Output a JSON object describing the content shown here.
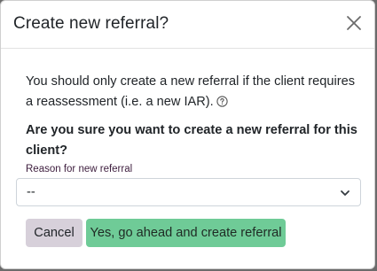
{
  "modal": {
    "title": "Create new referral?",
    "close_icon": "close-icon",
    "body_text": "You should only create a new referral if the client requires a reassessment (i.e. a new IAR).",
    "help_icon": "question-circle-icon",
    "question": "Are you sure you want to create a new referral for this client?",
    "reason_field": {
      "label": "Reason for new referral",
      "selected_value": "--",
      "dropdown_icon": "chevron-down-icon"
    },
    "buttons": {
      "cancel_label": "Cancel",
      "confirm_label": "Yes, go ahead and create referral"
    }
  },
  "colors": {
    "cancel_button": "#d7d0da",
    "confirm_button": "#6fcb97",
    "field_label": "#3d1d3d",
    "backdrop": "#6b6b6b"
  }
}
